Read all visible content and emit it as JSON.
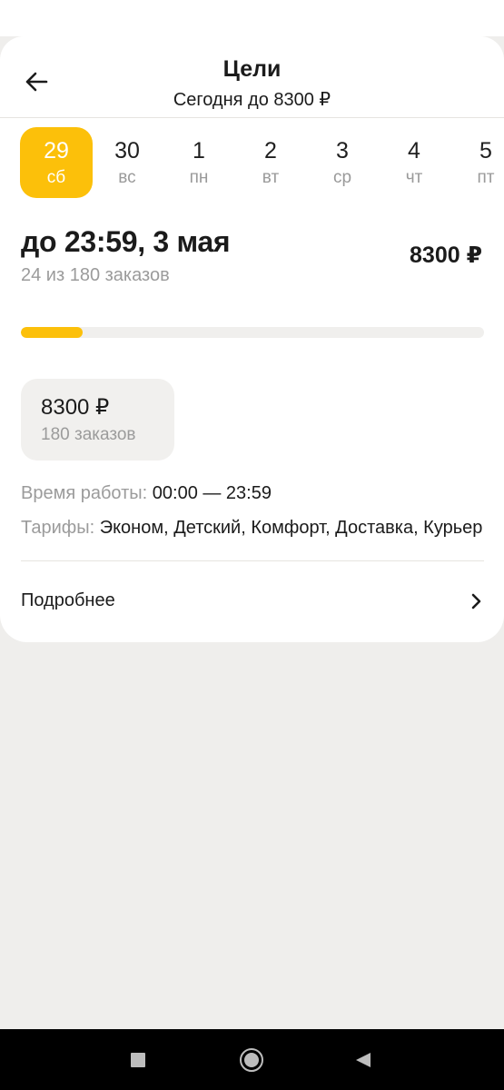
{
  "header": {
    "title": "Цели",
    "subtitle": "Сегодня до 8300 ₽"
  },
  "days": [
    {
      "num": "29",
      "weekday": "сб",
      "selected": true
    },
    {
      "num": "30",
      "weekday": "вс",
      "selected": false
    },
    {
      "num": "1",
      "weekday": "пн",
      "selected": false
    },
    {
      "num": "2",
      "weekday": "вт",
      "selected": false
    },
    {
      "num": "3",
      "weekday": "ср",
      "selected": false
    },
    {
      "num": "4",
      "weekday": "чт",
      "selected": false
    },
    {
      "num": "5",
      "weekday": "пт",
      "selected": false
    }
  ],
  "goal": {
    "deadline": "до 23:59, 3 мая",
    "orders_done": "24 из 180 заказов",
    "amount": "8300 ₽",
    "progress_fraction": 0.133
  },
  "tier": {
    "amount": "8300 ₽",
    "orders": "180 заказов"
  },
  "work_time": {
    "label": "Время работы:",
    "value": "00:00 — 23:59"
  },
  "tariffs": {
    "label": "Тарифы:",
    "value": "Эконом, Детский, Комфорт, Доставка, Курьер"
  },
  "details": {
    "label": "Подробнее"
  },
  "colors": {
    "accent": "#fcc00a",
    "background": "#efeeec",
    "secondary_text": "#9b9b9b"
  },
  "icons": {
    "back": "arrow-left-icon",
    "details": "chevron-right-icon",
    "nav_recent": "square-icon",
    "nav_home": "circle-icon",
    "nav_back": "triangle-icon"
  }
}
